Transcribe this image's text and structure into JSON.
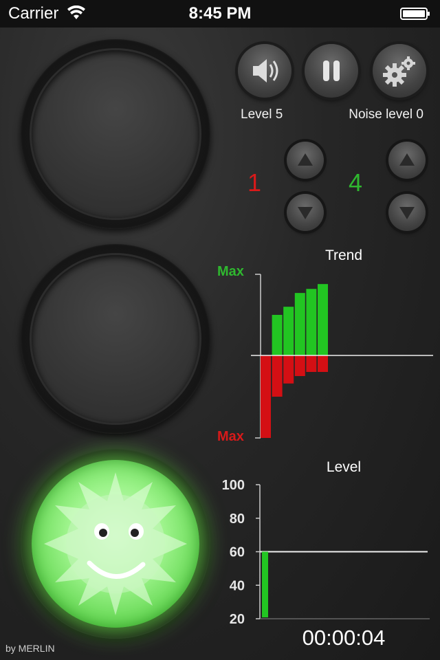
{
  "status_bar": {
    "carrier": "Carrier",
    "time": "8:45 PM"
  },
  "controls": {
    "level_label": "Level 5",
    "noise_label": "Noise level 0",
    "left_value": "1",
    "right_value": "4"
  },
  "colors": {
    "green": "#2fb82f",
    "red": "#d81a1a",
    "accent_bar_green": "#22c522",
    "accent_bar_red": "#d40f14"
  },
  "icons": [
    "wifi-icon",
    "battery-icon",
    "speaker-icon",
    "pause-icon",
    "gears-icon",
    "up-arrow-icon",
    "down-arrow-icon",
    "smiley-face-icon"
  ],
  "trend_chart": {
    "title": "Trend",
    "max_top_label": "Max",
    "max_bottom_label": "Max"
  },
  "level_chart": {
    "title": "Level",
    "y_ticks": [
      "100",
      "80",
      "60",
      "40",
      "20"
    ]
  },
  "chart_data": [
    {
      "type": "bar",
      "title": "Trend",
      "series": [
        {
          "name": "positive",
          "values": [
            0,
            0.5,
            0.6,
            0.77,
            0.82,
            0.88
          ]
        },
        {
          "name": "negative",
          "values": [
            -1.0,
            -0.5,
            -0.34,
            -0.25,
            -0.2,
            -0.2
          ]
        }
      ],
      "ylim": [
        -1,
        1
      ],
      "ylabel_top": "Max",
      "ylabel_bottom": "Max"
    },
    {
      "type": "bar",
      "title": "Level",
      "values": [
        60
      ],
      "reference_line": 60,
      "ylim": [
        20,
        100
      ],
      "yticks": [
        100,
        80,
        60,
        40,
        20
      ]
    }
  ],
  "timer": "00:00:04",
  "footer": "by MERLIN"
}
